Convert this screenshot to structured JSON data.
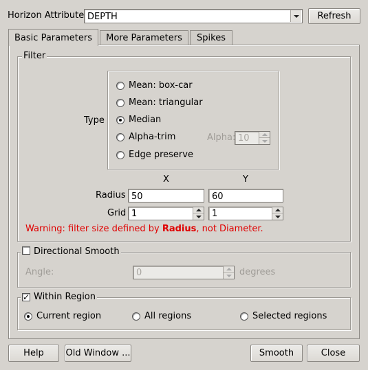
{
  "header": {
    "horizon_label": "Horizon Attribute",
    "horizon_value": "DEPTH",
    "refresh_label": "Refresh"
  },
  "tabs": [
    {
      "label": "Basic Parameters",
      "active": true
    },
    {
      "label": "More Parameters",
      "active": false
    },
    {
      "label": "Spikes",
      "active": false
    }
  ],
  "filter": {
    "title": "Filter",
    "type_label": "Type",
    "options": [
      {
        "label": "Mean: box-car",
        "selected": false
      },
      {
        "label": "Mean: triangular",
        "selected": false
      },
      {
        "label": "Median",
        "selected": true
      },
      {
        "label": "Alpha-trim",
        "selected": false
      },
      {
        "label": "Edge preserve",
        "selected": false
      }
    ],
    "alpha_label": "Alpha:",
    "alpha_value": "10",
    "x_header": "X",
    "y_header": "Y",
    "radius_label": "Radius",
    "radius_x": "50",
    "radius_y": "60",
    "grid_label": "Grid",
    "grid_x": "1",
    "grid_y": "1",
    "warning_prefix": "Warning: filter size defined by ",
    "warning_bold": "Radius",
    "warning_suffix": ", not Diameter.",
    "warning_color": "#e00000"
  },
  "directional": {
    "title": "Directional Smooth",
    "checked": false,
    "angle_label": "Angle:",
    "angle_value": "0",
    "unit": "degrees"
  },
  "region": {
    "title": "Within Region",
    "checked": true,
    "options": [
      {
        "label": "Current region",
        "selected": true
      },
      {
        "label": "All regions",
        "selected": false
      },
      {
        "label": "Selected regions",
        "selected": false
      }
    ]
  },
  "footer": {
    "help_label": "Help",
    "old_window_label": "Old Window ...",
    "smooth_label": "Smooth",
    "close_label": "Close"
  }
}
